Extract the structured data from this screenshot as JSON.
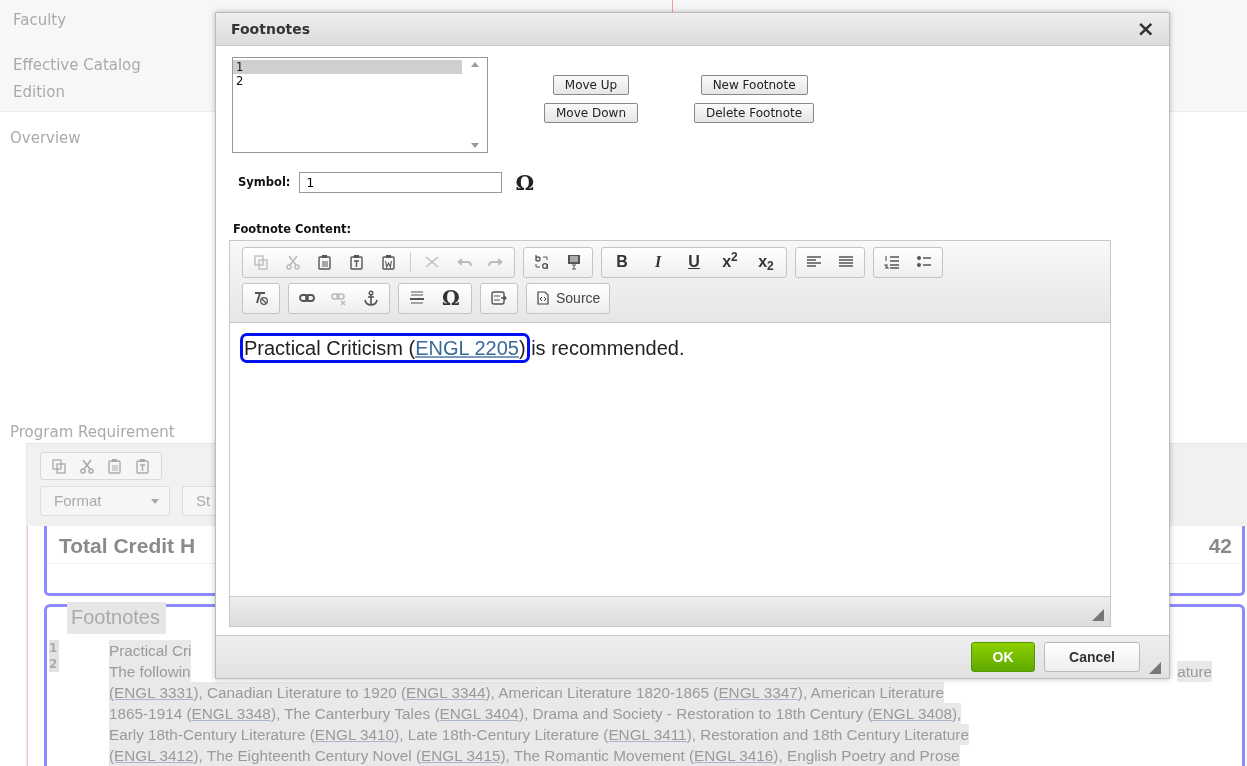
{
  "page": {
    "sidebar_labels": [
      "Faculty",
      "Effective Catalog Edition",
      "Overview",
      "Program Requirement"
    ],
    "editor": {
      "toolbar_icons": [
        {
          "kind": "icon",
          "disabled": false
        },
        {
          "kind": "icon",
          "disabled": false
        },
        {
          "kind": "icon",
          "disabled": false
        },
        {
          "kind": "icon",
          "disabled": false
        }
      ],
      "format_dropdown": "Format",
      "styles_dropdown": "St"
    },
    "total_label": "Total Credit H",
    "total_value": "42",
    "footnotes_legend": "Footnotes",
    "footnote_numbers": [
      "1",
      "2"
    ],
    "footnote_lines": [
      [
        {
          "kind": "text",
          "text": "Practical Cri"
        }
      ],
      [
        {
          "kind": "text",
          "text": "The followin"
        },
        {
          "kind": "gap"
        },
        {
          "kind": "text",
          "text": "ature"
        }
      ],
      [
        {
          "kind": "link",
          "text": "(ENGL 3331"
        },
        {
          "kind": "text",
          "text": "), Canadian Literature to 1920 ("
        },
        {
          "kind": "link",
          "text": "ENGL 3344"
        },
        {
          "kind": "text",
          "text": "), American Literature 1820-1865 ("
        },
        {
          "kind": "link",
          "text": "ENGL 3347"
        },
        {
          "kind": "text",
          "text": "), American Literature"
        }
      ],
      [
        {
          "kind": "text",
          "text": "1865-1914 ("
        },
        {
          "kind": "link",
          "text": "ENGL 3348"
        },
        {
          "kind": "text",
          "text": "), The Canterbury Tales ("
        },
        {
          "kind": "link",
          "text": "ENGL 3404"
        },
        {
          "kind": "text",
          "text": "), Drama and Society - Restoration to 18th Century ("
        },
        {
          "kind": "link",
          "text": "ENGL 3408"
        },
        {
          "kind": "text",
          "text": "),"
        }
      ],
      [
        {
          "kind": "text",
          "text": "Early 18th-Century Literature ("
        },
        {
          "kind": "link",
          "text": "ENGL 3410"
        },
        {
          "kind": "text",
          "text": "), Late 18th-Century Literature ("
        },
        {
          "kind": "link",
          "text": "ENGL 3411"
        },
        {
          "kind": "text",
          "text": "), Restoration and 18th Century Literature"
        }
      ],
      [
        {
          "kind": "link",
          "text": "(ENGL 3412"
        },
        {
          "kind": "text",
          "text": "), The Eighteenth Century Novel ("
        },
        {
          "kind": "link",
          "text": "ENGL 3415"
        },
        {
          "kind": "text",
          "text": "), The Romantic Movement ("
        },
        {
          "kind": "link",
          "text": "ENGL 3416"
        },
        {
          "kind": "text",
          "text": "), English Poetry and Prose"
        }
      ]
    ]
  },
  "dialog": {
    "title": "Footnotes",
    "close": "×",
    "footnote_list": [
      {
        "label": "1",
        "selected": true
      },
      {
        "label": "2",
        "selected": false
      }
    ],
    "buttons": [
      [
        "Move Up",
        "Move Down"
      ],
      [
        "New Footnote",
        "Delete Footnote"
      ]
    ],
    "symbol_label": "Symbol:",
    "symbol_value": "1",
    "symbol_glyph": "Ω",
    "content_label": "Footnote Content:",
    "toolbar": [
      [
        [
          {
            "kind": "icon",
            "disabled": true
          },
          {
            "kind": "icon",
            "disabled": true
          },
          {
            "kind": "icon",
            "disabled": false
          },
          {
            "kind": "icon",
            "disabled": false
          },
          {
            "kind": "icon",
            "disabled": false
          },
          {
            "kind": "separator"
          },
          {
            "kind": "icon",
            "disabled": true
          },
          {
            "kind": "icon",
            "disabled": true
          },
          {
            "kind": "icon",
            "disabled": true
          }
        ],
        [
          {
            "kind": "icon",
            "disabled": false
          },
          {
            "kind": "icon",
            "disabled": false
          }
        ],
        [
          {
            "kind": "glyph",
            "label": "B"
          },
          {
            "kind": "glyph",
            "label": "I"
          },
          {
            "kind": "glyph",
            "label": "U"
          },
          {
            "kind": "glyph",
            "label": "x$^{2}$"
          },
          {
            "kind": "glyph",
            "label": "x$_{2}$"
          }
        ],
        [
          {
            "kind": "icon",
            "disabled": false
          },
          {
            "kind": "icon",
            "disabled": false
          }
        ],
        [
          {
            "kind": "icon",
            "disabled": false
          },
          {
            "kind": "icon",
            "disabled": false
          }
        ]
      ],
      [
        [
          {
            "kind": "icon",
            "disabled": false
          }
        ],
        [
          {
            "kind": "icon",
            "disabled": false
          },
          {
            "kind": "icon",
            "disabled": true
          },
          {
            "kind": "icon",
            "disabled": false
          }
        ],
        [
          {
            "kind": "icon",
            "disabled": false
          },
          {
            "kind": "glyph",
            "label": "Ω"
          }
        ],
        [
          {
            "kind": "icon",
            "disabled": false
          }
        ],
        [
          {
            "kind": "button",
            "label": "Source"
          }
        ]
      ]
    ],
    "content": [
      {
        "selected": true,
        "parts": [
          {
            "kind": "text",
            "text": "Practical Criticism ("
          },
          {
            "kind": "link",
            "text": "ENGL 2205"
          },
          {
            "kind": "text",
            "text": ")"
          }
        ]
      },
      {
        "selected": false,
        "parts": [
          {
            "kind": "text",
            "text": " is recommended."
          }
        ]
      }
    ],
    "ok": "OK",
    "cancel": "Cancel"
  }
}
